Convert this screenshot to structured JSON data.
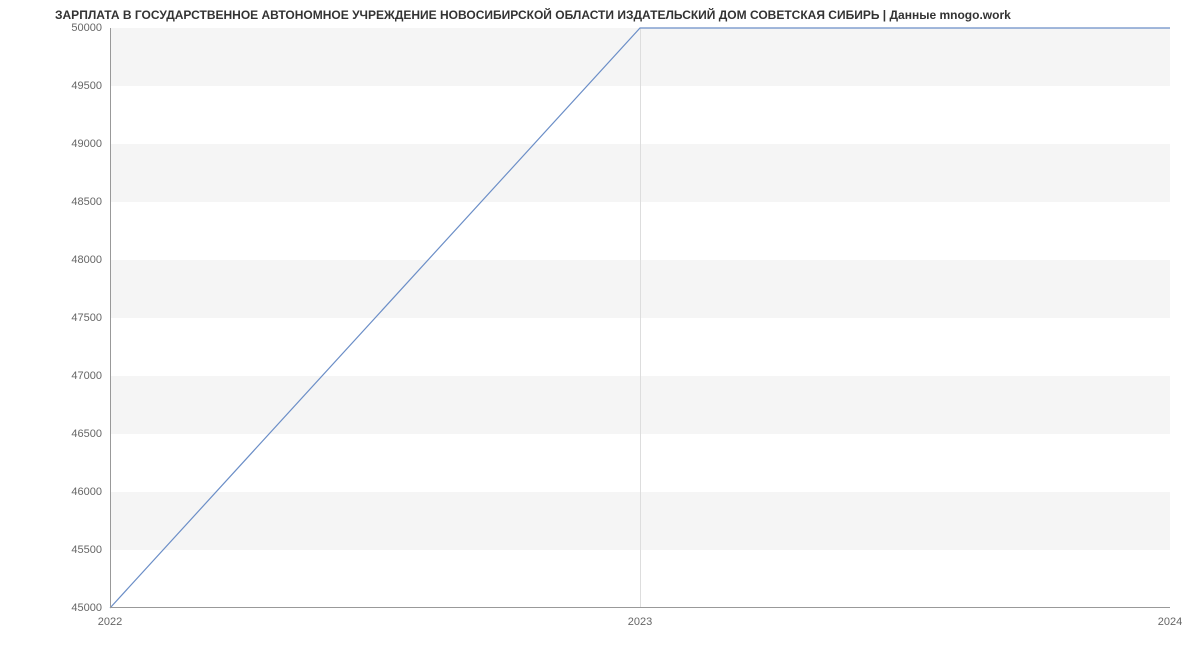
{
  "chart_data": {
    "type": "line",
    "title": "ЗАРПЛАТА В ГОСУДАРСТВЕННОЕ АВТОНОМНОЕ УЧРЕЖДЕНИЕ НОВОСИБИРСКОЙ ОБЛАСТИ ИЗДАТЕЛЬСКИЙ ДОМ СОВЕТСКАЯ СИБИРЬ | Данные mnogo.work",
    "x": [
      2022,
      2023,
      2024
    ],
    "values": [
      45000,
      50000,
      50000
    ],
    "xlabel": "",
    "ylabel": "",
    "xlim": [
      2022,
      2024
    ],
    "ylim": [
      45000,
      50000
    ],
    "x_ticks": [
      2022,
      2023,
      2024
    ],
    "y_ticks": [
      45000,
      45500,
      46000,
      46500,
      47000,
      47500,
      48000,
      48500,
      49000,
      49500,
      50000
    ]
  }
}
